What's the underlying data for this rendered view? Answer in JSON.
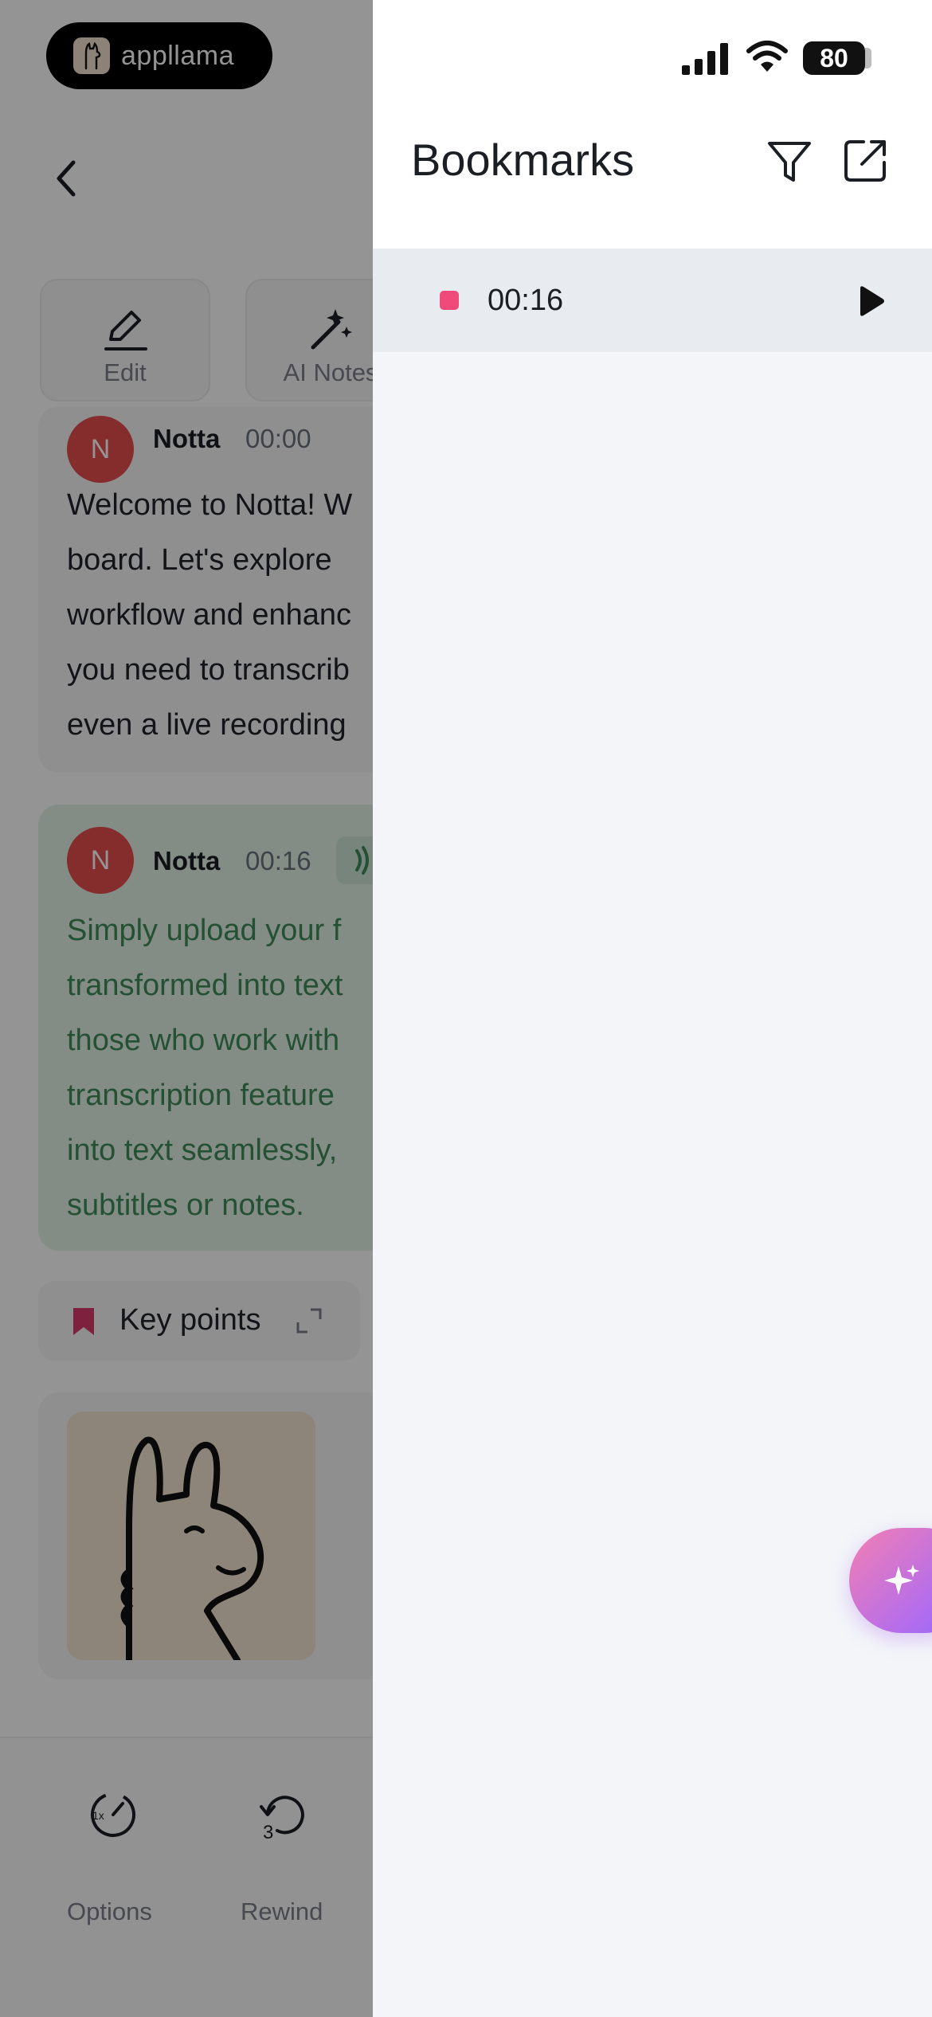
{
  "badge": {
    "brand_name": "appllama"
  },
  "toolbar": {
    "edit_label": "Edit",
    "ai_notes_label": "AI Notes"
  },
  "transcript": [
    {
      "avatar_letter": "N",
      "speaker": "Notta",
      "timestamp": "00:00",
      "lines": [
        "Welcome to Notta! W",
        "board. Let's explore",
        "workflow and enhanc",
        "you need to transcrib",
        "even a live recording"
      ]
    },
    {
      "avatar_letter": "N",
      "speaker": "Notta",
      "timestamp": "00:16",
      "lines": [
        "Simply upload your f",
        "transformed into text",
        "those who work with",
        "transcription feature",
        "into text seamlessly,",
        "subtitles or notes."
      ]
    }
  ],
  "key_points": {
    "label": "Key points"
  },
  "bottom_bar": {
    "options_label": "Options",
    "options_badge": "1x",
    "rewind_label": "Rewind",
    "rewind_seconds": "3"
  },
  "status_bar": {
    "battery": "80"
  },
  "bookmarks": {
    "title": "Bookmarks",
    "items": [
      {
        "time": "00:16",
        "color": "#ef4a7a"
      }
    ]
  },
  "colors": {
    "accent_pink": "#ef4a7a",
    "active_text": "#3e8a58",
    "avatar_red": "#e54c4c"
  }
}
